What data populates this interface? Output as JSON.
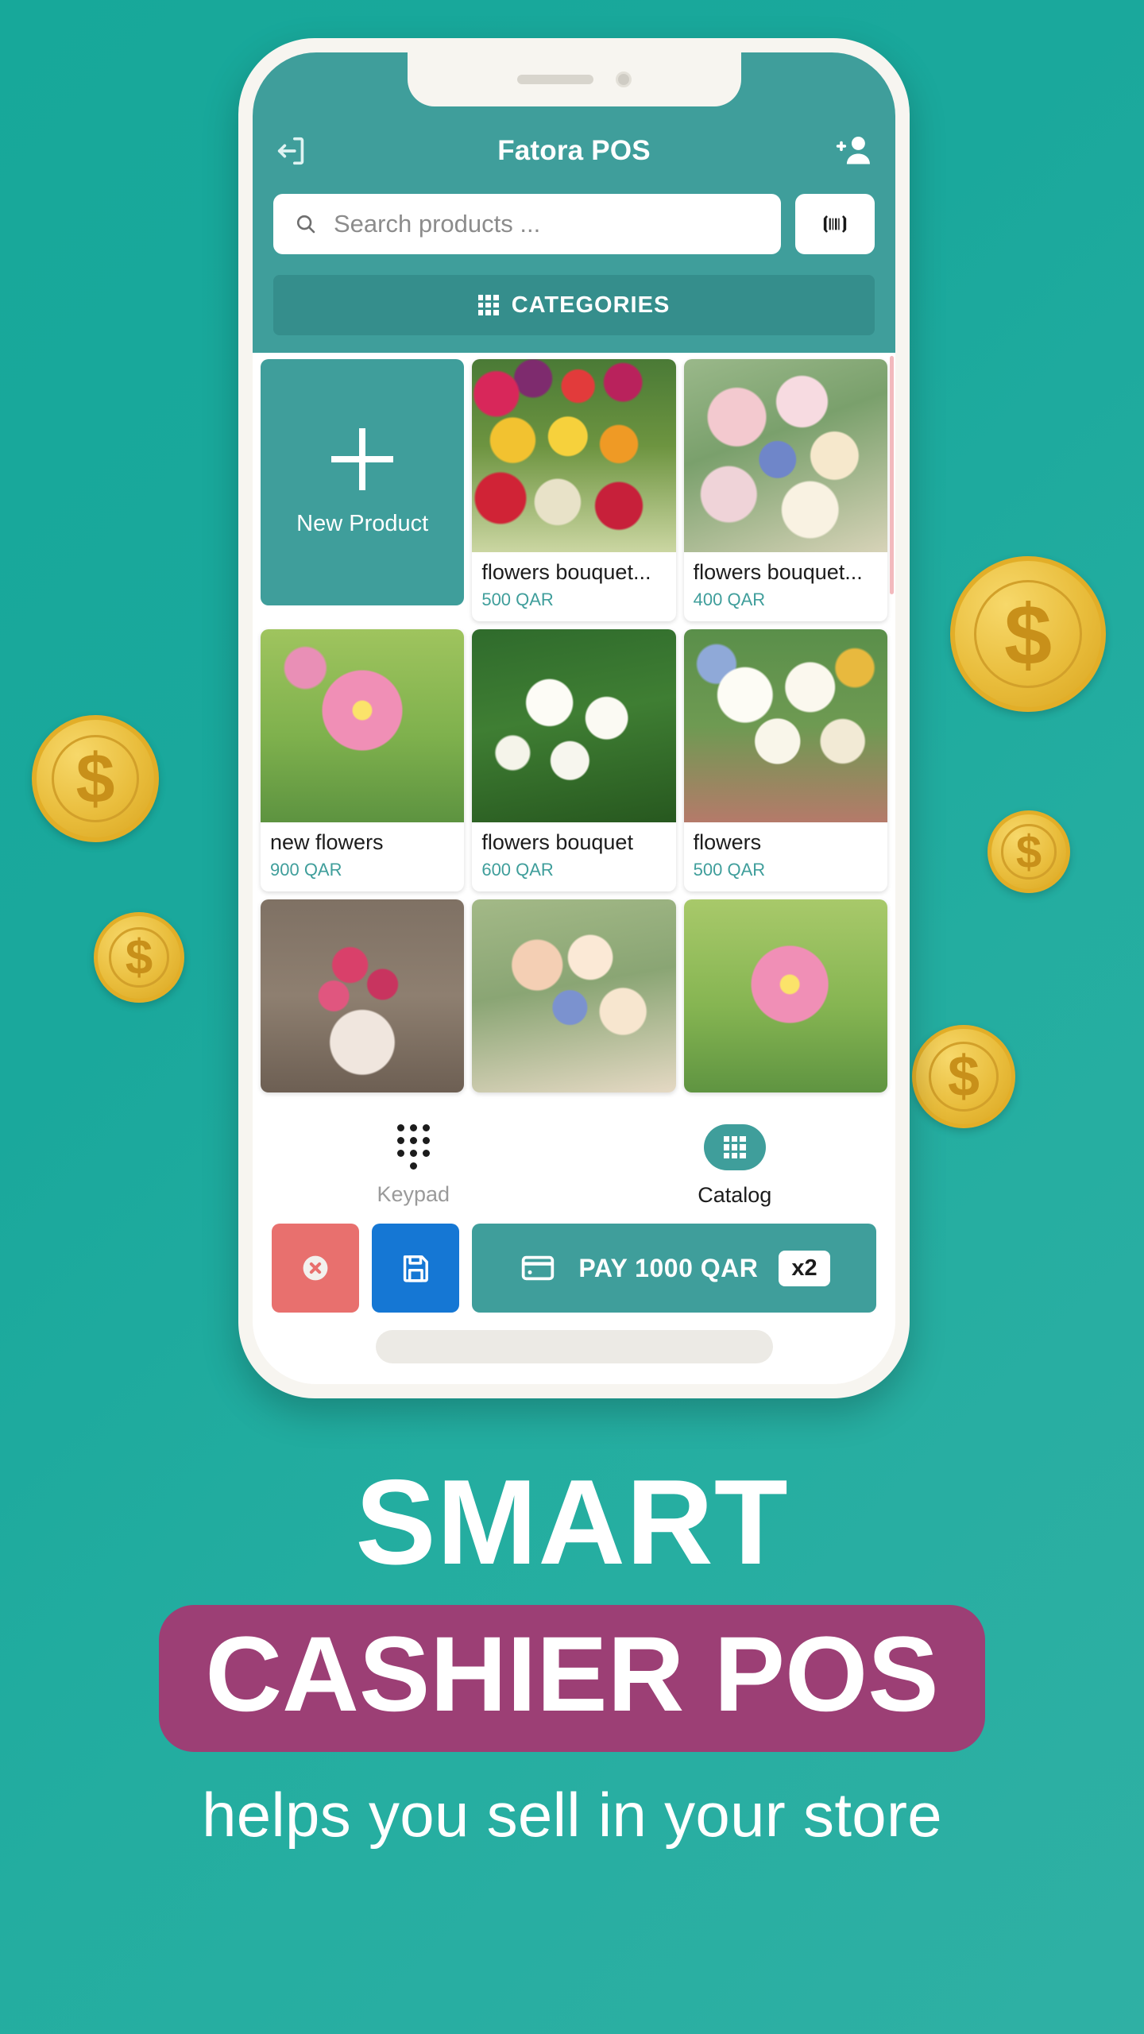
{
  "theme": {
    "background_gradient_from": "#17a89a",
    "background_gradient_to": "#2fb0a4",
    "app_teal": "#3f9e9b",
    "categories_teal": "#358e8c",
    "price_teal": "#3f9e9b",
    "band_magenta": "#9c3f75",
    "cancel_red": "#e8706e",
    "save_blue": "#1577d4"
  },
  "phone": {
    "notch": {
      "speaker_icon": "speaker-grille",
      "camera_icon": "front-camera"
    }
  },
  "app": {
    "header": {
      "title": "Fatora POS",
      "logout_icon": "logout-icon",
      "add_customer_icon": "add-user-icon"
    },
    "search": {
      "placeholder": "Search products ...",
      "value": "",
      "search_icon": "search-icon",
      "barcode_icon": "barcode-scan-icon"
    },
    "categories": {
      "label": "CATEGORIES",
      "icon": "grid-icon"
    },
    "new_product": {
      "label": "New Product",
      "icon": "plus-icon"
    },
    "products": [
      {
        "name": "flowers bouquet...",
        "price": "500 QAR",
        "image": "tulips-mixed"
      },
      {
        "name": "flowers bouquet...",
        "price": "400 QAR",
        "image": "pastel-bouquet"
      },
      {
        "name": "new flowers",
        "price": "900 QAR",
        "image": "pink-cosmos"
      },
      {
        "name": "flowers bouquet",
        "price": "600 QAR",
        "image": "white-jasmine"
      },
      {
        "name": "flowers",
        "price": "500 QAR",
        "image": "white-tulip-bouquet"
      },
      {
        "name": "",
        "price": "",
        "image": "pink-roses-wrapped"
      },
      {
        "name": "",
        "price": "",
        "image": "pastel-wrapped-bouquet"
      },
      {
        "name": "",
        "price": "",
        "image": "pink-cosmos-field"
      }
    ],
    "bottom_nav": [
      {
        "label": "Keypad",
        "icon": "keypad-icon",
        "active": false
      },
      {
        "label": "Catalog",
        "icon": "grid-icon",
        "active": true
      }
    ],
    "actions": {
      "cancel_icon": "cancel-circle-icon",
      "save_icon": "save-floppy-icon",
      "pay_icon": "credit-card-icon",
      "pay_label": "PAY 1000 QAR",
      "pay_quantity": "x2"
    }
  },
  "marketing": {
    "line1": "SMART",
    "line2": "CASHIER POS",
    "line3": "helps you sell in your store"
  },
  "coins": [
    {
      "symbol": "$"
    },
    {
      "symbol": "$"
    },
    {
      "symbol": "$"
    },
    {
      "symbol": "$"
    },
    {
      "symbol": "$"
    }
  ]
}
